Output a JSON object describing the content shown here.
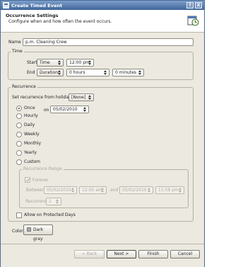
{
  "window": {
    "title": "Create Timed Event",
    "help_label": "?",
    "close_label": "X"
  },
  "header": {
    "title": "Occurrence Settings",
    "description": "Configure when and how often the event occurs."
  },
  "name": {
    "label": "Name",
    "value": "p.m. Cleaning Crew"
  },
  "time": {
    "group_label": "Time",
    "start_label": "Start",
    "start_mode": "Time",
    "start_time": "12:00 pm",
    "end_label": "End",
    "end_mode": "Duration",
    "hours": "0 hours",
    "minutes": "0 minutes"
  },
  "recurrence": {
    "group_label": "Recurrence",
    "holiday_label": "Set recurrence from holiday:",
    "holiday_value": "[None]",
    "options": [
      "Once",
      "Hourly",
      "Daily",
      "Weekly",
      "Monthly",
      "Yearly",
      "Custom"
    ],
    "selected": "Once",
    "on_label": "on",
    "on_date": "05/02/2010",
    "range": {
      "group_label": "Recurrence Range",
      "forever_label": "Forever",
      "between_label": "Between",
      "start_date": "05/02/2010",
      "start_time": "12:00 am",
      "and_label": "and",
      "end_date": "05/02/2010",
      "end_time": "11:59 pm",
      "recurrences_label": "Recurrences",
      "recurrences_value": "1"
    },
    "protected_days_label": "Allow on Protected Days"
  },
  "color": {
    "label": "Color",
    "value": "Dark gray",
    "swatch": "#a9a9a9"
  },
  "footer": {
    "back": "< Back",
    "next": "Next >",
    "finish": "Finish",
    "cancel": "Cancel"
  }
}
